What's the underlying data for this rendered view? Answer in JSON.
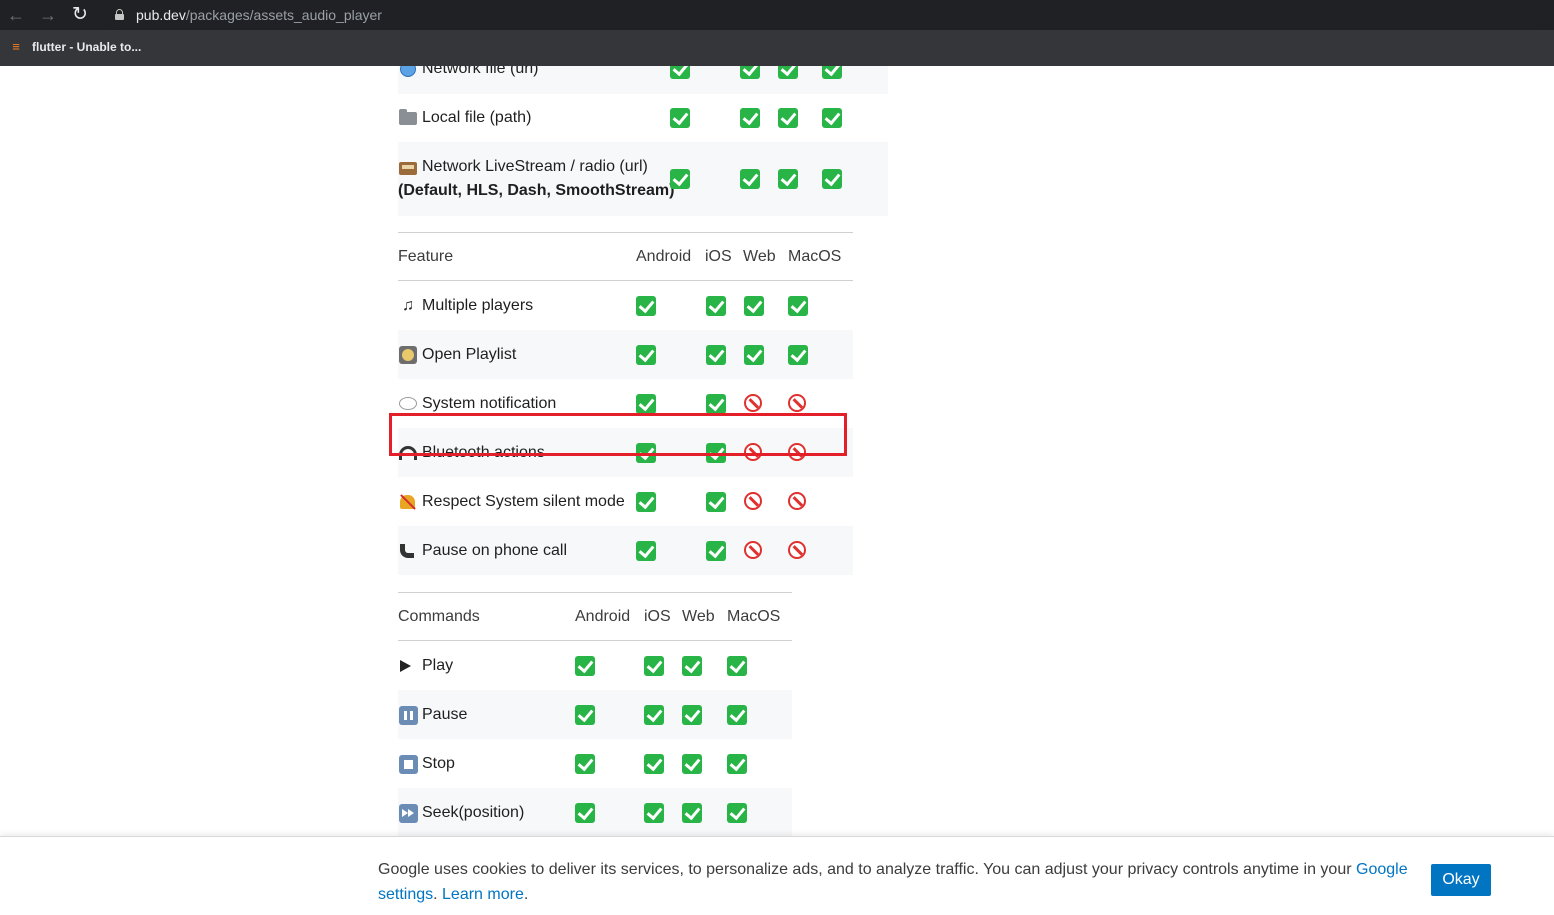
{
  "browser": {
    "url_host": "pub.dev",
    "url_path": "/packages/assets_audio_player",
    "bookmark_label": "flutter - Unable to..."
  },
  "sources_table": {
    "rows": [
      {
        "label": "Network file (url)",
        "icon": "globe-icon",
        "marks": [
          "yes",
          "yes",
          "yes",
          "yes"
        ]
      },
      {
        "label": "Local file (path)",
        "icon": "folder-icon",
        "marks": [
          "yes",
          "yes",
          "yes",
          "yes"
        ]
      },
      {
        "label": "Network LiveStream / radio (url)",
        "label2": "(Default, HLS, Dash, SmoothStream)",
        "icon": "radio-icon",
        "marks": [
          "yes",
          "yes",
          "yes",
          "yes"
        ]
      }
    ]
  },
  "feature_table": {
    "headers": [
      "Feature",
      "Android",
      "iOS",
      "Web",
      "MacOS"
    ],
    "rows": [
      {
        "label": "Multiple players",
        "icon": "musical-notes-icon",
        "marks": [
          "yes",
          "yes",
          "yes",
          "yes"
        ]
      },
      {
        "label": "Open Playlist",
        "icon": "disc-icon",
        "marks": [
          "yes",
          "yes",
          "yes",
          "yes"
        ]
      },
      {
        "label": "System notification",
        "icon": "speech-bubble-icon",
        "marks": [
          "yes",
          "yes",
          "no",
          "no"
        ]
      },
      {
        "label": "Bluetooth actions",
        "icon": "headphones-icon",
        "marks": [
          "yes",
          "yes",
          "no",
          "no"
        ]
      },
      {
        "label": "Respect System silent mode",
        "icon": "muted-bell-icon",
        "marks": [
          "yes",
          "yes",
          "no",
          "no"
        ]
      },
      {
        "label": "Pause on phone call",
        "icon": "phone-icon",
        "marks": [
          "yes",
          "yes",
          "no",
          "no"
        ]
      }
    ]
  },
  "commands_table": {
    "headers": [
      "Commands",
      "Android",
      "iOS",
      "Web",
      "MacOS"
    ],
    "rows": [
      {
        "label": "Play",
        "icon": "play-icon",
        "marks": [
          "yes",
          "yes",
          "yes",
          "yes"
        ]
      },
      {
        "label": "Pause",
        "icon": "pause-icon",
        "marks": [
          "yes",
          "yes",
          "yes",
          "yes"
        ]
      },
      {
        "label": "Stop",
        "icon": "stop-icon",
        "marks": [
          "yes",
          "yes",
          "yes",
          "yes"
        ]
      },
      {
        "label": "Seek(position)",
        "icon": "fast-forward-icon",
        "marks": [
          "yes",
          "yes",
          "yes",
          "yes"
        ]
      }
    ]
  },
  "cookie_banner": {
    "text": "Google uses cookies to deliver its services, to personalize ads, and to analyze traffic. You can adjust your privacy controls anytime in your ",
    "link_settings": "Google settings",
    "separator": ". ",
    "link_learn": "Learn more",
    "end": ".",
    "button": "Okay"
  },
  "colors": {
    "check_green": "#28b446",
    "prohibited_red": "#e0312f",
    "highlight_red": "#e3202a",
    "link_blue": "#0175c2"
  }
}
